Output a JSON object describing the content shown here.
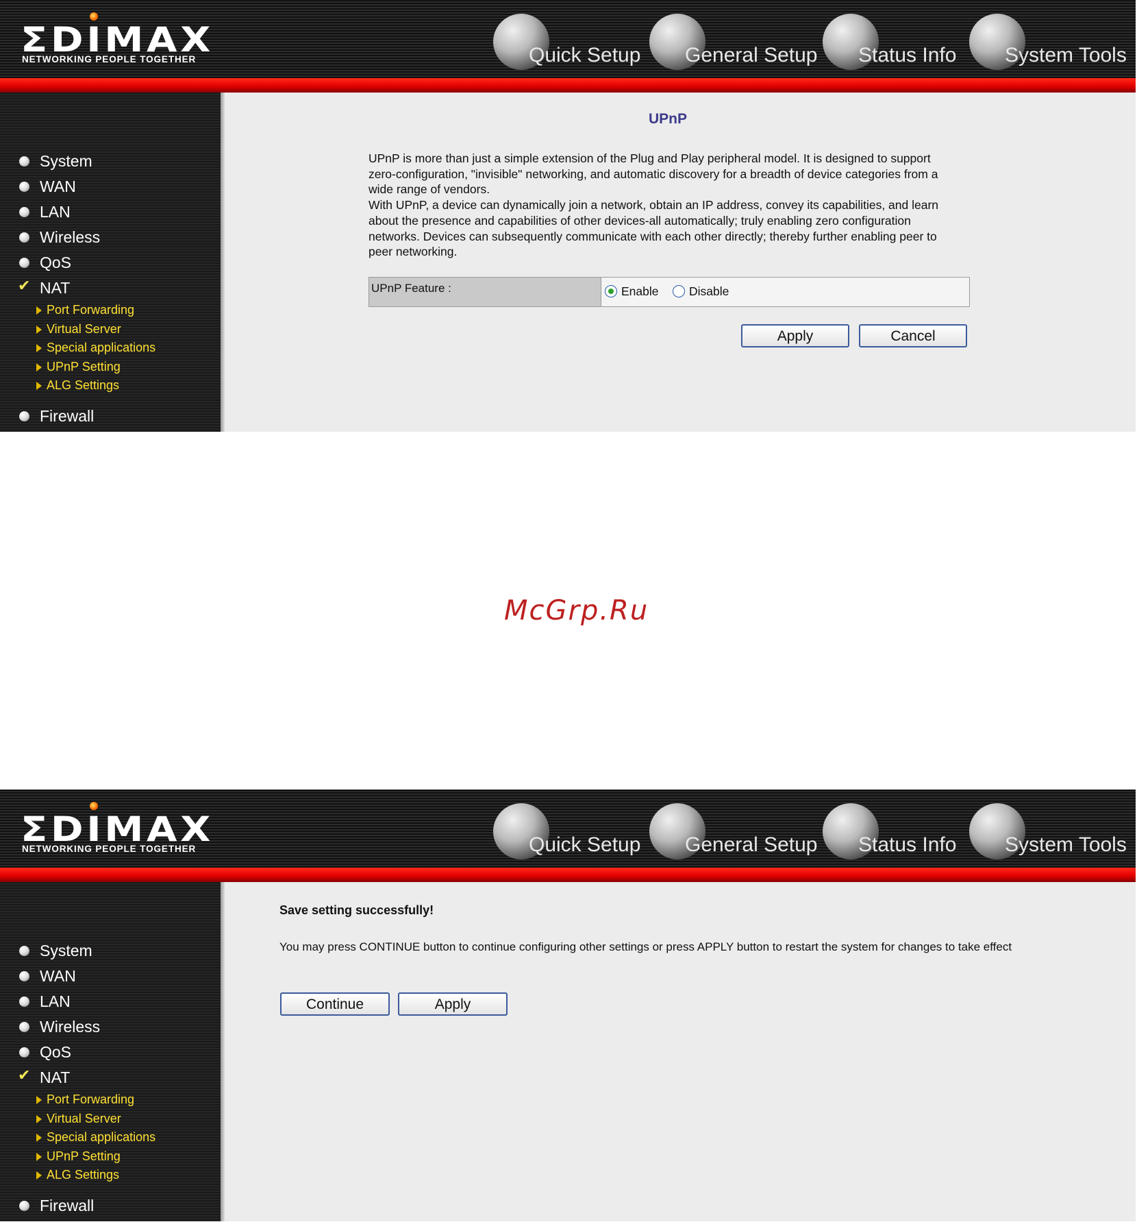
{
  "screens": [
    {
      "header": {
        "logo_word": "ΣDIMAX",
        "logo_tagline": "NETWORKING PEOPLE TOGETHER",
        "nav": [
          "Quick Setup",
          "General Setup",
          "Status Info",
          "System Tools"
        ]
      },
      "sidebar": {
        "items": [
          "System",
          "WAN",
          "LAN",
          "Wireless",
          "QoS"
        ],
        "active": "NAT",
        "subitems": [
          "Port Forwarding",
          "Virtual Server",
          "Special applications",
          "UPnP Setting",
          "ALG Settings"
        ],
        "after": "Firewall"
      },
      "content": {
        "title": "UPnP",
        "para1": "UPnP is more than just a simple extension of the Plug and Play peripheral model. It is designed to support zero-configuration, \"invisible\" networking, and automatic discovery for a breadth of device categories from a wide range of vendors.",
        "para2": "With UPnP, a device can dynamically join a network, obtain an IP address, convey its capabilities, and learn about the presence and capabilities of other devices-all automatically; truly enabling zero configuration networks. Devices can subsequently communicate with each other directly; thereby further enabling peer to peer networking.",
        "feature_label": "UPnP Feature :",
        "enable_label": "Enable",
        "disable_label": "Disable",
        "selected": "Enable",
        "apply": "Apply",
        "cancel": "Cancel"
      }
    },
    {
      "header": {
        "logo_word": "ΣDIMAX",
        "logo_tagline": "NETWORKING PEOPLE TOGETHER",
        "nav": [
          "Quick Setup",
          "General Setup",
          "Status Info",
          "System Tools"
        ]
      },
      "sidebar": {
        "items": [
          "System",
          "WAN",
          "LAN",
          "Wireless",
          "QoS"
        ],
        "active": "NAT",
        "subitems": [
          "Port Forwarding",
          "Virtual Server",
          "Special applications",
          "UPnP Setting",
          "ALG Settings"
        ],
        "after": "Firewall"
      },
      "content": {
        "title": "Save setting successfully!",
        "message": "You may press CONTINUE button to continue configuring other settings or press APPLY button to restart the system for changes to take effect",
        "continue": "Continue",
        "apply": "Apply"
      }
    }
  ],
  "watermark": "McGrp.Ru"
}
